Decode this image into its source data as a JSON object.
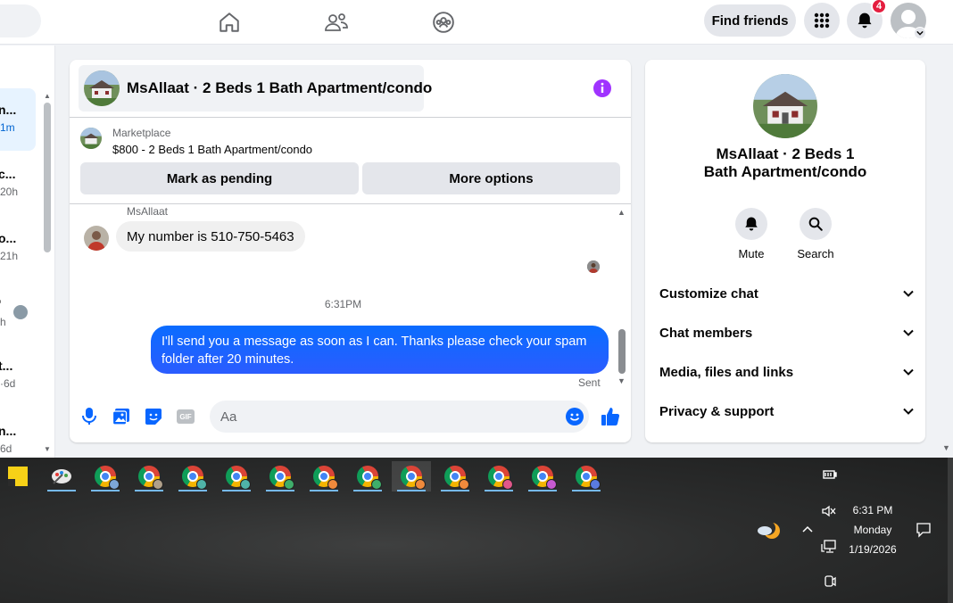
{
  "topnav": {
    "find_friends": "Find friends",
    "notification_count": "4",
    "icons": [
      "home-icon",
      "friends-icon",
      "groups-icon",
      "menu-grid-icon",
      "bell-icon",
      "account-avatar"
    ]
  },
  "chat_list": {
    "items": [
      {
        "name": "n...",
        "time": "1m",
        "active": true
      },
      {
        "name": "c...",
        "time": "20h"
      },
      {
        "name": "o...",
        "time": "21h"
      },
      {
        "name": "'",
        "time": "h"
      },
      {
        "name": "t...",
        "time": "·6d"
      },
      {
        "name": "n...",
        "time": "6d"
      }
    ]
  },
  "chat": {
    "title": "MsAllaat · 2 Beds 1 Bath Apartment/condo",
    "marketplace_label": "Marketplace",
    "listing": "$800 - 2 Beds 1 Bath Apartment/condo",
    "mark_pending": "Mark as pending",
    "more_options": "More options",
    "sender_name": "MsAllaat",
    "incoming_message": "My number is 510-750-5463",
    "timestamp": "6:31PM",
    "outgoing_message": "I'll send you a message as soon as I can. Thanks please check your spam folder after 20 minutes.",
    "status": "Sent",
    "composer_placeholder": "Aa",
    "gif_label": "GIF"
  },
  "info_panel": {
    "name": "MsAllaat · 2 Beds 1 Bath Apartment/condo",
    "mute": "Mute",
    "search": "Search",
    "sections": [
      "Customize chat",
      "Chat members",
      "Media, files and links",
      "Privacy & support"
    ]
  },
  "taskbar": {
    "time": "6:31 PM",
    "day": "Monday",
    "date": "1/19/2026",
    "app_count": 12
  },
  "colors": {
    "brand_blue": "#0866ff",
    "outgoing_bubble": "#0a7cff",
    "info_purple": "#a033ff",
    "badge_red": "#e41e3f"
  }
}
